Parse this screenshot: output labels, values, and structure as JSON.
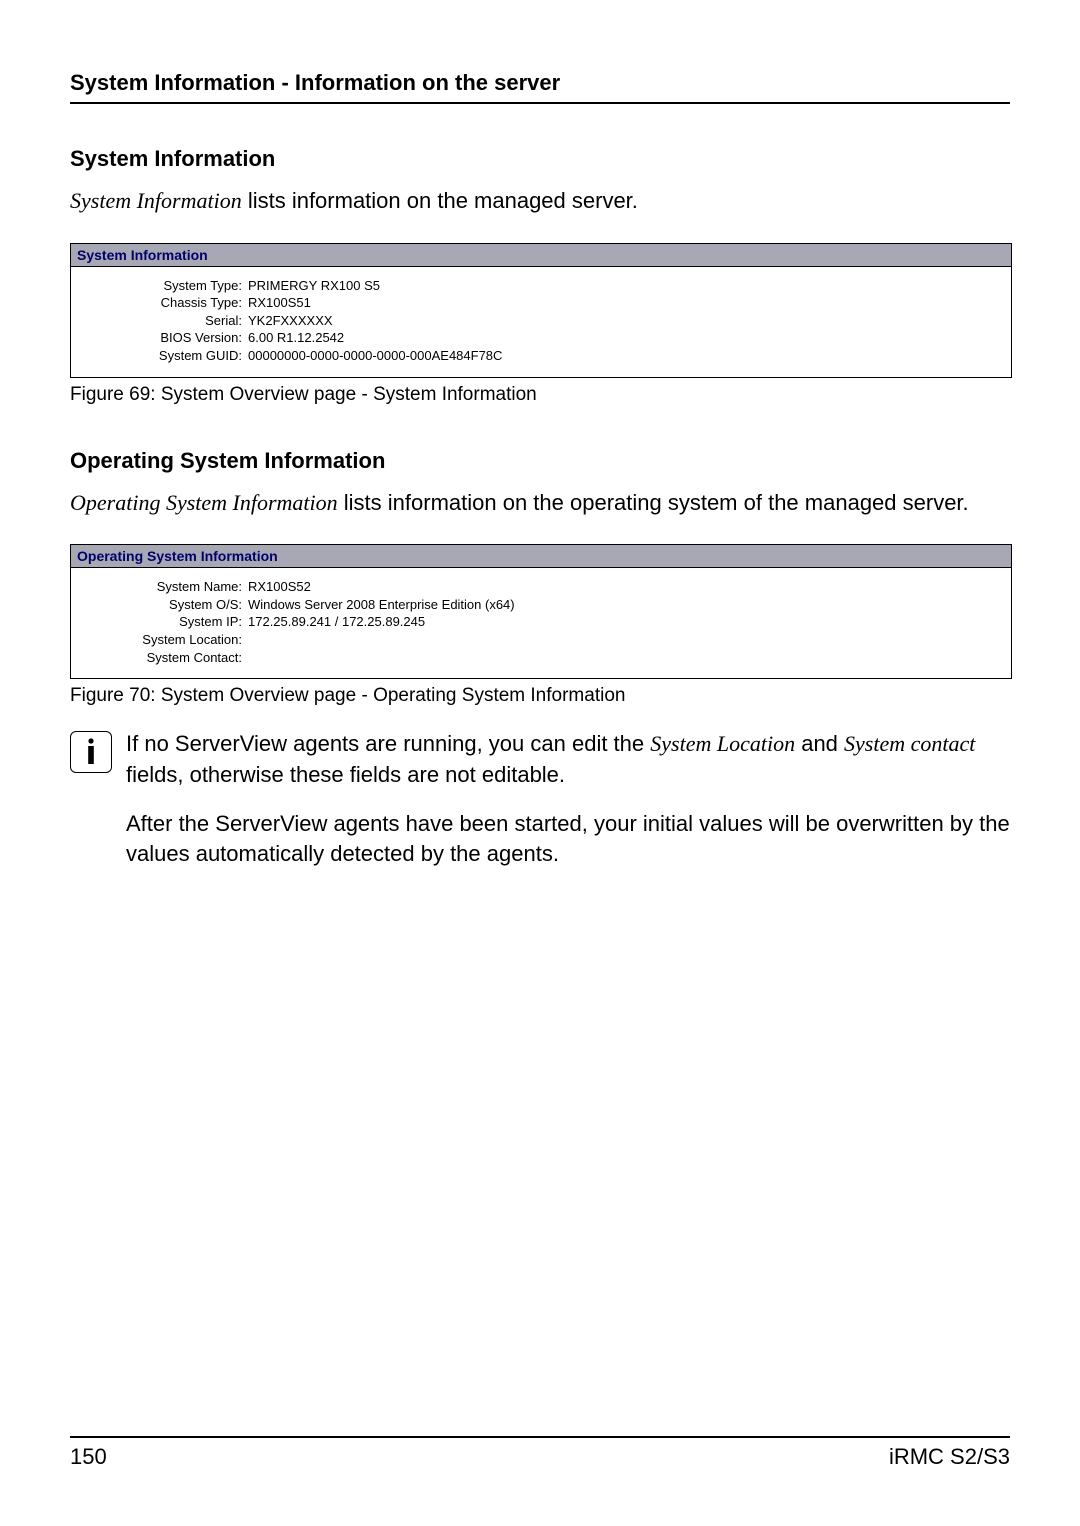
{
  "header": {
    "title": "System Information - Information on the server"
  },
  "section_sys": {
    "heading": "System Information",
    "intro_italic": "System Information",
    "intro_rest": " lists information on the managed server.",
    "panel_title": "System Information",
    "rows": [
      {
        "label": "System Type:",
        "value": "PRIMERGY RX100 S5"
      },
      {
        "label": "Chassis Type:",
        "value": "RX100S51"
      },
      {
        "label": "Serial:",
        "value": "YK2FXXXXXX"
      },
      {
        "label": "BIOS Version:",
        "value": "6.00 R1.12.2542"
      },
      {
        "label": "System GUID:",
        "value": "00000000-0000-0000-0000-000AE484F78C"
      }
    ],
    "caption": "Figure 69: System Overview page - System Information"
  },
  "section_os": {
    "heading": "Operating System Information",
    "intro_italic": "Operating System Information",
    "intro_rest": " lists information on the operating system of the managed server.",
    "panel_title": "Operating System Information",
    "rows": [
      {
        "label": "System Name:",
        "value": "RX100S52"
      },
      {
        "label": "System O/S:",
        "value": "Windows Server 2008 Enterprise Edition (x64)"
      },
      {
        "label": "System IP:",
        "value": "172.25.89.241 / 172.25.89.245"
      },
      {
        "label": "System Location:",
        "value": ""
      },
      {
        "label": "System Contact:",
        "value": ""
      }
    ],
    "caption": "Figure 70: System Overview page - Operating System Information"
  },
  "note": {
    "p1_a": "If no ServerView agents are running, you can edit the ",
    "p1_i1": "System Location",
    "p1_b": " and ",
    "p1_i2": "System contact",
    "p1_c": " fields, otherwise these fields are not editable.",
    "p2": "After the ServerView agents have been started, your initial values will be overwritten by the values automatically detected by the agents."
  },
  "footer": {
    "page_number": "150",
    "doc_id": "iRMC S2/S3"
  }
}
